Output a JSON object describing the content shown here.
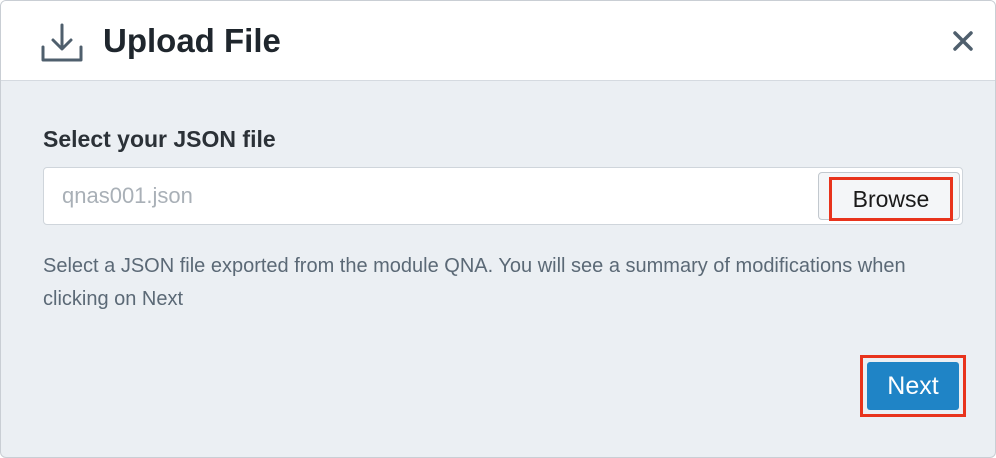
{
  "dialog": {
    "title": "Upload File",
    "header_icon": "download-icon",
    "close_icon": "close-icon"
  },
  "form": {
    "label": "Select your JSON file",
    "file_value": "qnas001.json",
    "browse_label": "Browse",
    "help_text": "Select a JSON file exported from the module QNA. You will see a summary of modifications when clicking on Next"
  },
  "footer": {
    "next_label": "Next"
  },
  "colors": {
    "primary": "#1f84c6",
    "highlight": "#e8331c",
    "background": "#ebeff3"
  }
}
